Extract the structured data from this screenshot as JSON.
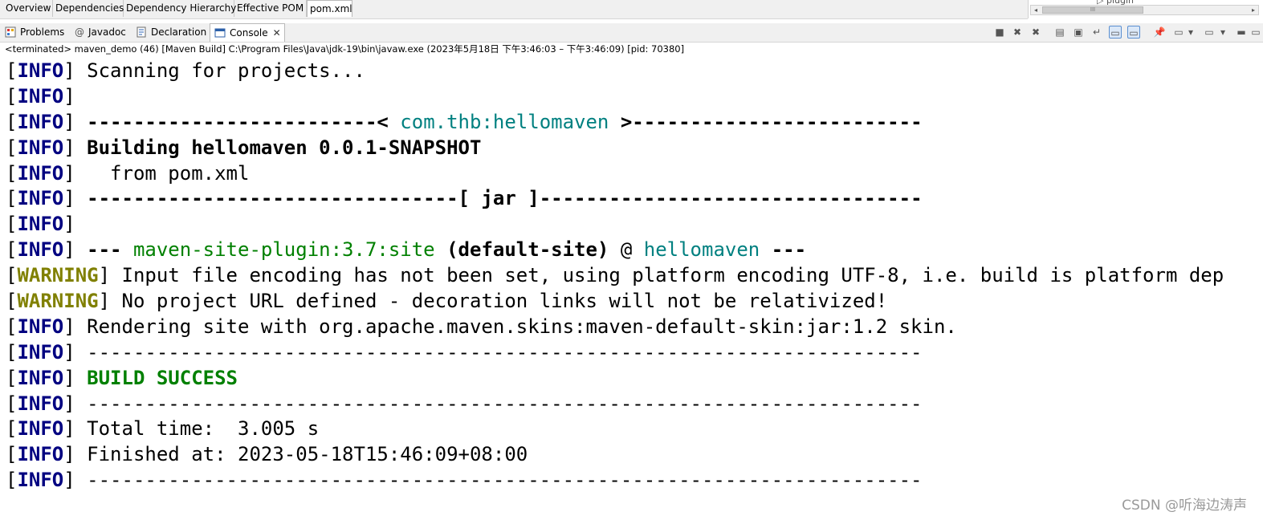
{
  "editor_tabs": [
    {
      "label": "Overview"
    },
    {
      "label": "Dependencies"
    },
    {
      "label": "Dependency Hierarchy"
    },
    {
      "label": "Effective POM"
    },
    {
      "label": "pom.xml",
      "active": true
    }
  ],
  "outline": {
    "partial_text": "plugin"
  },
  "view_tabs": [
    {
      "label": "Problems",
      "icon": "problems-icon"
    },
    {
      "label": "Javadoc",
      "icon": "javadoc-icon"
    },
    {
      "label": "Declaration",
      "icon": "declaration-icon"
    },
    {
      "label": "Console",
      "icon": "console-icon",
      "active": true
    }
  ],
  "status_line": "<terminated> maven_demo (46) [Maven Build] C:\\Program Files\\Java\\jdk-19\\bin\\javaw.exe  (2023年5月18日 下午3:46:03 – 下午3:46:09) [pid: 70380]",
  "console": {
    "bracket_open": "[",
    "bracket_close": "]",
    "levels": {
      "info": "INFO",
      "warning": "WARNING"
    },
    "lines": [
      {
        "level": "info",
        "text": "Scanning for projects..."
      },
      {
        "level": "info",
        "text": ""
      },
      {
        "level": "info",
        "pre": "-------------------------< ",
        "artifact": "com.thb:hellomaven",
        "post": " >-------------------------"
      },
      {
        "level": "info",
        "text": "Building hellomaven 0.0.1-SNAPSHOT"
      },
      {
        "level": "info",
        "text": "  from pom.xml"
      },
      {
        "level": "info",
        "pre": "--------------------------------",
        "packaging": "[ jar ]",
        "post": "---------------------------------"
      },
      {
        "level": "info",
        "text": ""
      },
      {
        "level": "info",
        "dashes": "--- ",
        "plugin": "maven-site-plugin:3.7:site",
        "execution": "(default-site)",
        "at": " @ ",
        "project": "hellomaven",
        "tail": " ---"
      },
      {
        "level": "warning",
        "text": "Input file encoding has not been set, using platform encoding UTF-8, i.e. build is platform dep"
      },
      {
        "level": "warning",
        "text": "No project URL defined - decoration links will not be relativized!"
      },
      {
        "level": "info",
        "text": "Rendering site with org.apache.maven.skins:maven-default-skin:jar:1.2 skin."
      },
      {
        "level": "info",
        "text": "------------------------------------------------------------------------"
      },
      {
        "level": "info",
        "status": "BUILD SUCCESS"
      },
      {
        "level": "info",
        "text": "------------------------------------------------------------------------"
      },
      {
        "level": "info",
        "text": "Total time:  3.005 s"
      },
      {
        "level": "info",
        "text": "Finished at: 2023-05-18T15:46:09+08:00"
      },
      {
        "level": "info",
        "text": "------------------------------------------------------------------------"
      }
    ]
  },
  "watermark": "CSDN @听海边涛声",
  "colors": {
    "info": "#000080",
    "warning": "#808000",
    "artifact": "#008080",
    "plugin": "#008000",
    "success": "#008000"
  }
}
